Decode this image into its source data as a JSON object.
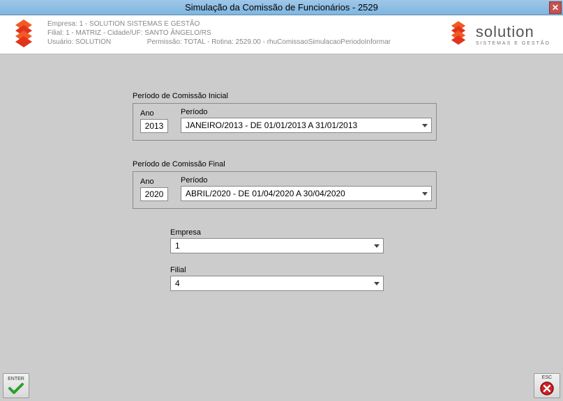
{
  "window": {
    "title": "Simulação da Comissão de Funcionários - 2529"
  },
  "header": {
    "line1": "Empresa: 1 - SOLUTION SISTEMAS E GESTÃO",
    "line2": "Filial: 1 - MATRIZ - Cidade/UF: SANTO ÂNGELO/RS",
    "line3_left": "Usuário: SOLUTION",
    "line3_right": "Permissão: TOTAL - Rotina: 2529.00 - rhuComissaoSimulacaoPeriodoInformar"
  },
  "brand": {
    "name": "solution",
    "sub": "SISTEMAS E GESTÃO"
  },
  "periodo_inicial": {
    "title": "Período de Comissão Inicial",
    "ano_label": "Ano",
    "ano_value": "2013",
    "periodo_label": "Período",
    "periodo_value": "JANEIRO/2013 - DE 01/01/2013 A 31/01/2013"
  },
  "periodo_final": {
    "title": "Período de Comissão Final",
    "ano_label": "Ano",
    "ano_value": "2020",
    "periodo_label": "Período",
    "periodo_value": "ABRIL/2020 - DE 01/04/2020 A 30/04/2020"
  },
  "empresa": {
    "label": "Empresa",
    "value": "1"
  },
  "filial": {
    "label": "Filial",
    "value": "4"
  },
  "buttons": {
    "enter": "ENTER",
    "esc": "ESC"
  }
}
